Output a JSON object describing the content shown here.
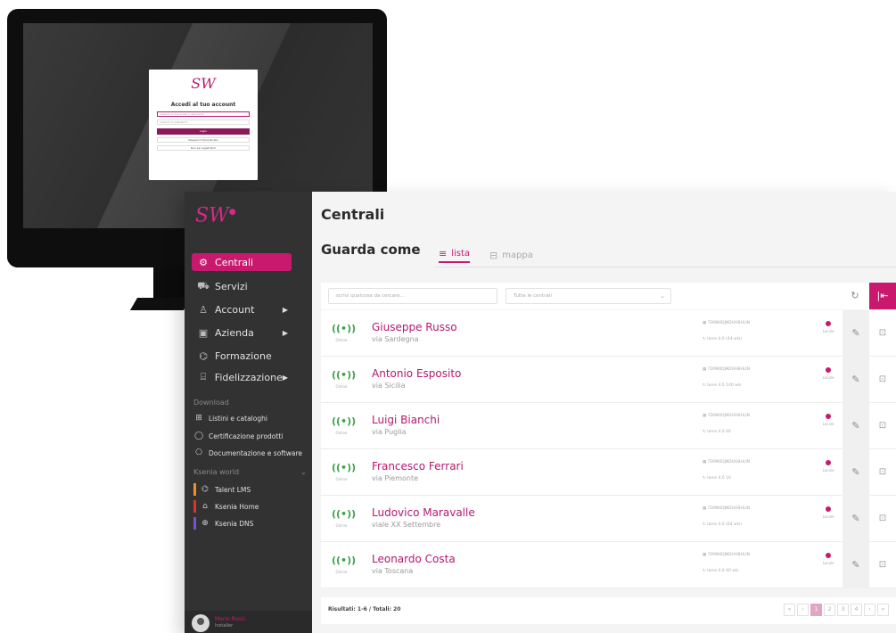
{
  "monitor": {
    "login": {
      "logo": "SW",
      "title": "Accedi al tuo account",
      "username_placeholder": "Inserisci la tua email o username",
      "password_placeholder": "Inserisci la password",
      "login_button": "Login",
      "secondary_link": "Password dimenticata",
      "register_link": "Non sei registrato?"
    }
  },
  "app": {
    "logo": "SW",
    "sidebar": {
      "items": [
        {
          "label": "Centrali",
          "icon": "gear-icon",
          "active": true,
          "has_arrow": false
        },
        {
          "label": "Servizi",
          "icon": "cart-icon",
          "active": false,
          "has_arrow": false
        },
        {
          "label": "Account",
          "icon": "user-icon",
          "active": false,
          "has_arrow": true
        },
        {
          "label": "Azienda",
          "icon": "building-icon",
          "active": false,
          "has_arrow": true
        },
        {
          "label": "Formazione",
          "icon": "graduation-icon",
          "active": false,
          "has_arrow": false
        },
        {
          "label": "Fidelizzazione",
          "icon": "gift-icon",
          "active": false,
          "has_arrow": true
        }
      ],
      "download_section": "Download",
      "download_items": [
        {
          "label": "Listini e cataloghi",
          "icon": "book-icon"
        },
        {
          "label": "Certificazione prodotti",
          "icon": "certificate-icon"
        },
        {
          "label": "Documentazione e software",
          "icon": "archive-icon"
        }
      ],
      "world_section": "Ksenia world",
      "world_items": [
        {
          "label": "Talent LMS",
          "icon": "graduation-icon",
          "color": "#f28c28"
        },
        {
          "label": "Ksenia Home",
          "icon": "home-icon",
          "color": "#e0312d"
        },
        {
          "label": "Ksenia DNS",
          "icon": "globe-icon",
          "color": "#7b4fd0"
        }
      ]
    },
    "header": {
      "title": "Centrali",
      "view_label": "Guarda come",
      "tabs": [
        {
          "label": "lista",
          "icon": "list-icon",
          "active": true
        },
        {
          "label": "mappa",
          "icon": "map-icon",
          "active": false
        }
      ]
    },
    "toolbar": {
      "search_placeholder": "scrivi qualcosa da cercare...",
      "filter_value": "Tutte le centrali"
    },
    "rows": [
      {
        "name": "Giuseppe Russo",
        "address": "via Sardegna",
        "signal_label": "Online",
        "serial": "▦ 7D9N0DJNDUHBHLIN",
        "version": "↻ lares 4.0 (44 wls)",
        "status_label": "Locale"
      },
      {
        "name": "Antonio Esposito",
        "address": "via Sicilia",
        "signal_label": "Online",
        "serial": "▦ 7D9N0DJNDUHBHLIN",
        "version": "↻ lares 4.0 140 wls",
        "status_label": "Locale"
      },
      {
        "name": "Luigi Bianchi",
        "address": "via Puglia",
        "signal_label": "Online",
        "serial": "▦ 7D9N0DJNDUHBHLIN",
        "version": "↻ lares 4.0 40",
        "status_label": "Locale"
      },
      {
        "name": "Francesco Ferrari",
        "address": "via Piemonte",
        "signal_label": "Online",
        "serial": "▦ 7D9N0DJNDUHBHLIN",
        "version": "↻ lares 4.0 16",
        "status_label": "Locale"
      },
      {
        "name": "Ludovico Maravalle",
        "address": "viale XX Settembre",
        "signal_label": "Online",
        "serial": "▦ 7D9N0DJNDUHBHLIN",
        "version": "↻ lares 4.0 (64 wls)",
        "status_label": "Locale"
      },
      {
        "name": "Leonardo Costa",
        "address": "via Toscana",
        "signal_label": "Online",
        "serial": "▦ 7D9N0DJNDUHBHLIN",
        "version": "↻ lares 4.0 40 wls",
        "status_label": "Locale"
      }
    ],
    "footer": {
      "results": "Risultati: 1-6 / Totali: 20",
      "pager": [
        "«",
        "‹",
        "1",
        "2",
        "3",
        "4",
        "›",
        "»"
      ],
      "current_page": "1"
    },
    "user": {
      "name": "Mario Rossi",
      "role": "Installer"
    },
    "colors": {
      "accent": "#c8196f",
      "sidebar": "#323232",
      "online": "#3ea24a"
    }
  }
}
